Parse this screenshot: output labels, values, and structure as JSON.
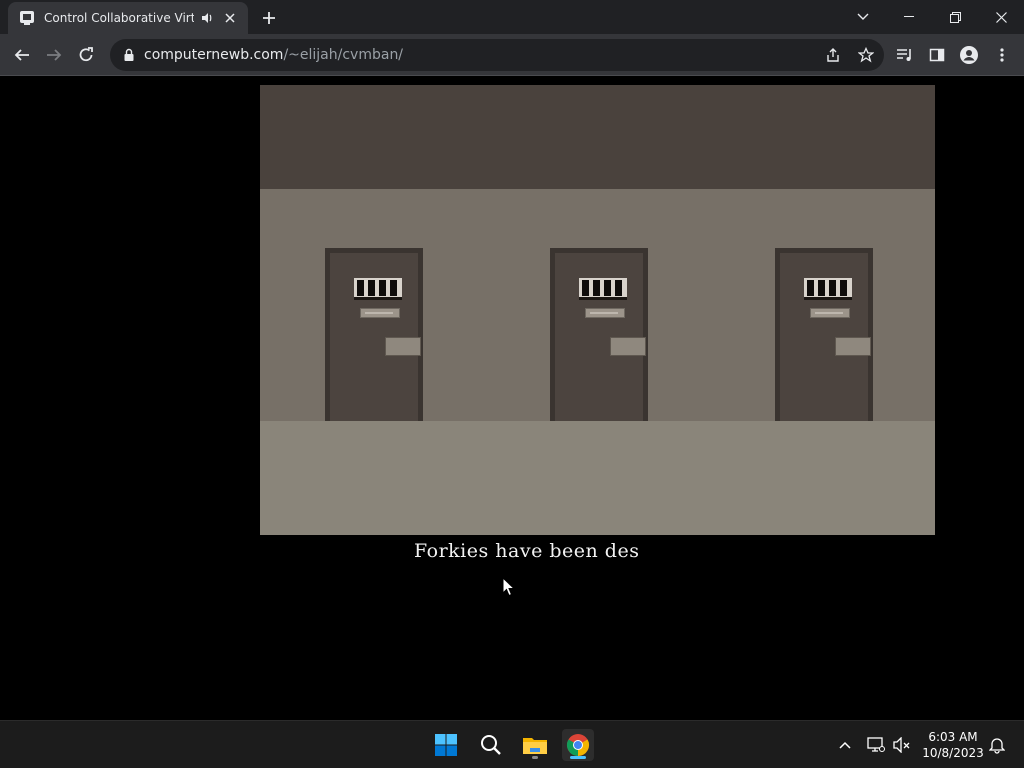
{
  "browser": {
    "tab": {
      "title": "Control Collaborative Virtual Machine"
    },
    "address": {
      "domain": "computernewb.com",
      "path": "/~elijah/cvmban/"
    }
  },
  "game": {
    "caption": "Forkies have been des",
    "colors": {
      "ceiling": "#4a423d",
      "wall": "#777067",
      "floor": "#8a857a",
      "door": "#4c443f"
    },
    "door_count": 3
  },
  "taskbar": {
    "apps": [
      "start-icon",
      "search-icon",
      "file-explorer-icon",
      "chrome-icon"
    ],
    "clock": {
      "time": "6:03 AM",
      "date": "10/8/2023"
    }
  }
}
